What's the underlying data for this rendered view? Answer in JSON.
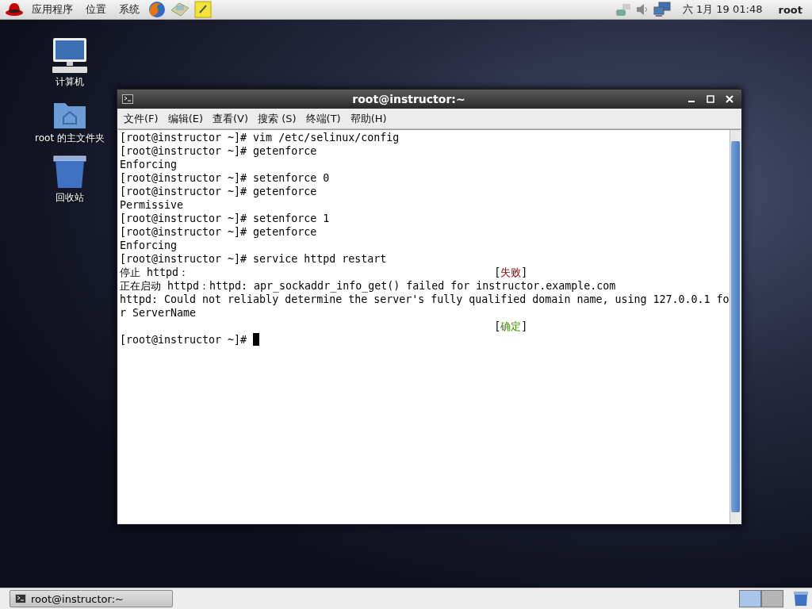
{
  "top_panel": {
    "menus": [
      "应用程序",
      "位置",
      "系统"
    ],
    "clock": "六  1月 19 01:48",
    "user": "root"
  },
  "desktop_icons": [
    {
      "label": "计算机",
      "kind": "computer"
    },
    {
      "label": "root 的主文件夹",
      "kind": "home"
    },
    {
      "label": "回收站",
      "kind": "trash"
    }
  ],
  "window": {
    "title": "root@instructor:~",
    "menu": [
      "文件(F)",
      "编辑(E)",
      "查看(V)",
      "搜索 (S)",
      "终端(T)",
      "帮助(H)"
    ],
    "lines": [
      {
        "text": "[root@instructor ~]# vim /etc/selinux/config"
      },
      {
        "text": "[root@instructor ~]# getenforce"
      },
      {
        "text": "Enforcing"
      },
      {
        "text": "[root@instructor ~]# setenforce 0"
      },
      {
        "text": "[root@instructor ~]# getenforce"
      },
      {
        "text": "Permissive"
      },
      {
        "text": "[root@instructor ~]# setenforce 1"
      },
      {
        "text": "[root@instructor ~]# getenforce"
      },
      {
        "text": "Enforcing"
      },
      {
        "text": "[root@instructor ~]# service httpd restart"
      },
      {
        "text": "停止 httpd：",
        "status": {
          "open": "[",
          "label": "失败",
          "close": "]",
          "kind": "fail"
        }
      },
      {
        "text": "正在启动 httpd：httpd: apr_sockaddr_info_get() failed for instructor.example.com"
      },
      {
        "text": "httpd: Could not reliably determine the server's fully qualified domain name, using 127.0.0.1 fo"
      },
      {
        "text": "r ServerName"
      },
      {
        "status": {
          "open": "[",
          "label": "确定",
          "close": "]",
          "kind": "ok"
        }
      },
      {
        "text": "[root@instructor ~]# ",
        "cursor": true
      }
    ]
  },
  "taskbar": {
    "tasks": [
      {
        "label": "root@instructor:~",
        "selected": false
      }
    ],
    "workspaces": [
      {
        "selected": true
      },
      {
        "selected": false
      }
    ]
  }
}
